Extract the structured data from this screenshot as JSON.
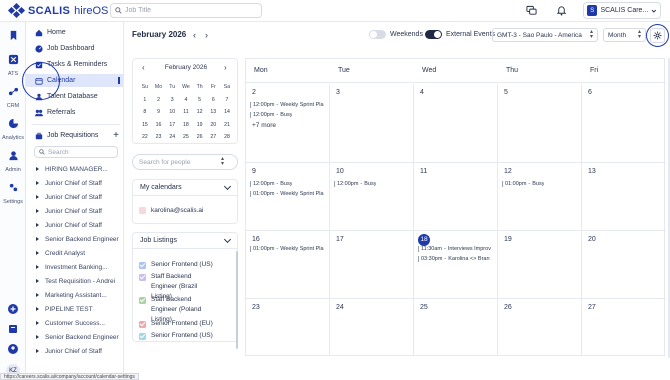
{
  "brand": {
    "name": "SCALIS",
    "product": "hireOS"
  },
  "topbar": {
    "search_placeholder": "Job Title",
    "org_name": "SCALIS Care...",
    "org_initial": "S"
  },
  "rail": [
    {
      "label": "",
      "icon": "bookmark-icon"
    },
    {
      "label": "ATS",
      "icon": "ats-icon"
    },
    {
      "label": "CRM",
      "icon": "crm-icon"
    },
    {
      "label": "Analytics",
      "icon": "analytics-icon"
    },
    {
      "label": "Admin",
      "icon": "admin-icon"
    },
    {
      "label": "Settings",
      "icon": "settings-icon"
    }
  ],
  "user_initials": "KZ",
  "nav": {
    "items": [
      "Home",
      "Job Dashboard",
      "Tasks & Reminders",
      "Calendar",
      "Talent Database",
      "Referrals"
    ],
    "active": "Calendar",
    "job_requisitions_label": "Job Requisitions",
    "search_placeholder": "Search",
    "requisitions": [
      "HIRING MANAGER...",
      "Junior Chief of Staff",
      "Junior Chief of Staff",
      "Junior Chief of Staff",
      "Junior Chief of Staff",
      "Senior Backend Engineer",
      "Credit Analyst",
      "Investment Banking...",
      "Test Requisition - Andrei",
      "Marketing Assistant...",
      "PIPELINE TEST",
      "Customer Success...",
      "Senior Backend Engineer",
      "Junior Chief of Staff"
    ]
  },
  "status_url": "https://careers.scalis.ai/company/account/calendar-settings",
  "header": {
    "month_title": "February 2026",
    "weekends_label": "Weekends",
    "weekends_on": false,
    "external_label": "External Events",
    "external_on": true,
    "timezone": "GMT-3 - Sao Paulo - America",
    "view": "Month"
  },
  "mini_calendar": {
    "title": "February 2026",
    "dow": [
      "Su",
      "Mo",
      "Tu",
      "We",
      "Th",
      "Fr",
      "Sa"
    ],
    "days": [
      [
        "1",
        "2",
        "3",
        "4",
        "5",
        "6",
        "7"
      ],
      [
        "8",
        "9",
        "10",
        "11",
        "12",
        "13",
        "14"
      ],
      [
        "15",
        "16",
        "17",
        "18",
        "19",
        "20",
        "21"
      ],
      [
        "22",
        "23",
        "24",
        "25",
        "26",
        "27",
        "28"
      ]
    ]
  },
  "people_search_placeholder": "Search for people",
  "my_calendars": {
    "title": "My calendars",
    "items": [
      {
        "label": "karolina@scalis.ai",
        "color": "#f6d9dc",
        "checked": false
      }
    ]
  },
  "job_listings": {
    "title": "Job Listings",
    "items": [
      {
        "label": "Senior Frontend (US)",
        "color": "#a9c3f2",
        "checked": true
      },
      {
        "label": "Staff Backend Engineer (Brazil Listing)",
        "color": "#c8c0ec",
        "checked": true
      },
      {
        "label": "Staff Backend Engineer (Poland Listing)",
        "color": "#a8d4a4",
        "checked": true
      },
      {
        "label": "Senior Frontend (EU)",
        "color": "#f0a7ad",
        "checked": true
      },
      {
        "label": "Senior Frontend (US)",
        "color": "#9fd8ec",
        "checked": true
      }
    ]
  },
  "month_grid": {
    "dow": [
      "Mon",
      "Tue",
      "Wed",
      "Thu",
      "Fri"
    ],
    "weeks": [
      [
        {
          "day": "2",
          "events": [
            {
              "time": "12:00pm",
              "title": "Weekly Sprint Pla"
            },
            {
              "time": "12:00pm",
              "title": "Busy"
            }
          ],
          "more": "+7 more"
        },
        {
          "day": "3",
          "events": []
        },
        {
          "day": "4",
          "events": []
        },
        {
          "day": "5",
          "events": []
        },
        {
          "day": "6",
          "events": []
        }
      ],
      [
        {
          "day": "9",
          "events": [
            {
              "time": "12:00pm",
              "title": "Busy"
            },
            {
              "time": "01:00pm",
              "title": "Weekly Sprint Pla"
            }
          ]
        },
        {
          "day": "10",
          "events": [
            {
              "time": "12:00pm",
              "title": "Busy"
            }
          ]
        },
        {
          "day": "11",
          "events": []
        },
        {
          "day": "12",
          "events": [
            {
              "time": "01:00pm",
              "title": "Busy"
            }
          ]
        },
        {
          "day": "13",
          "events": []
        }
      ],
      [
        {
          "day": "16",
          "events": [
            {
              "time": "01:00pm",
              "title": "Weekly Sprint Pla"
            }
          ]
        },
        {
          "day": "17",
          "events": []
        },
        {
          "day": "18",
          "today": true,
          "events": [
            {
              "time": "11:30am",
              "title": "Interviews Improv"
            },
            {
              "time": "03:30pm",
              "title": "Karolina <> Bran"
            }
          ]
        },
        {
          "day": "19",
          "events": []
        },
        {
          "day": "20",
          "events": []
        }
      ],
      [
        {
          "day": "23",
          "events": []
        },
        {
          "day": "24",
          "events": []
        },
        {
          "day": "25",
          "events": []
        },
        {
          "day": "26",
          "events": []
        },
        {
          "day": "27",
          "events": []
        }
      ]
    ]
  }
}
